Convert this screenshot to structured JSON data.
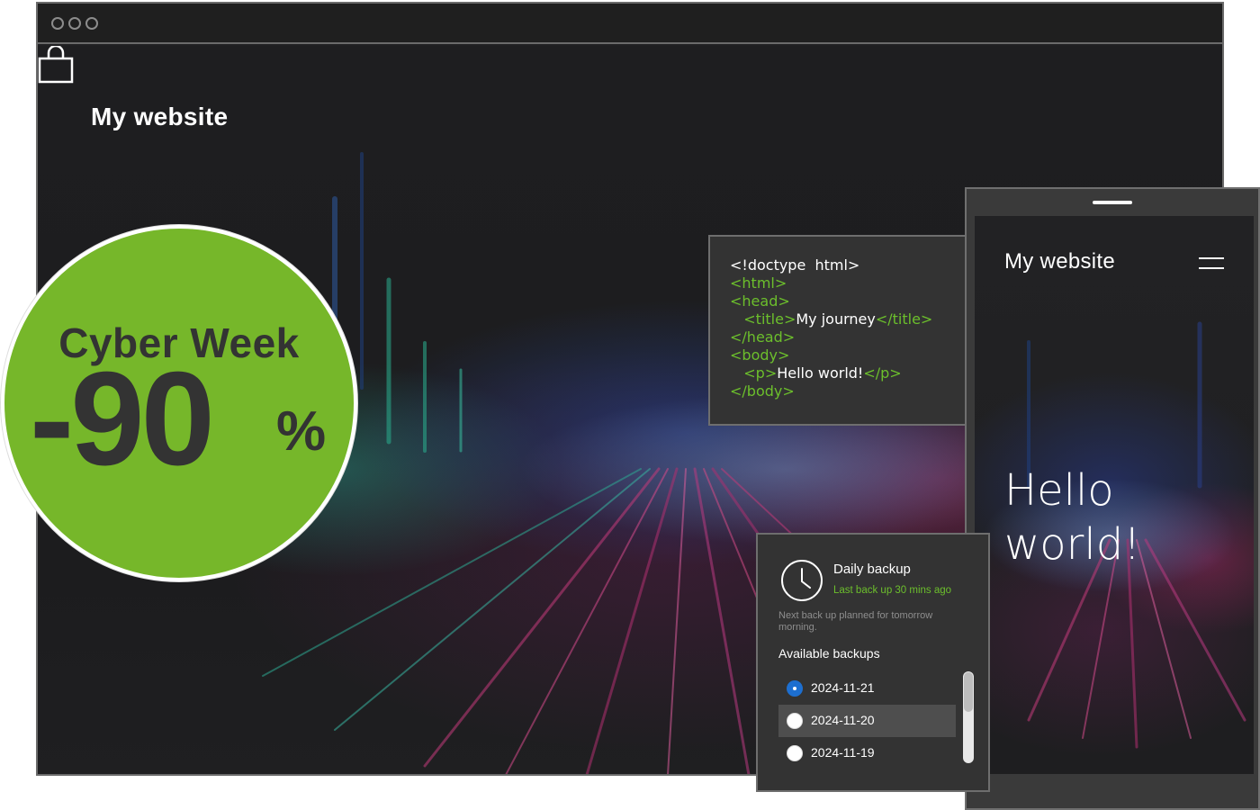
{
  "desktop": {
    "site_title": "My website",
    "cart_icon": "shopping-bag-icon",
    "window_controls": [
      "circle",
      "circle",
      "circle"
    ]
  },
  "promo": {
    "title": "Cyber Week",
    "value": "-90",
    "unit": "%",
    "background": "#76b72a",
    "text_color": "#333333"
  },
  "code_panel": {
    "lines": [
      {
        "pre": "",
        "text": "<!doctype  html>",
        "color": "white"
      },
      {
        "pre": "",
        "text": "<html>",
        "color": "green"
      },
      {
        "pre": "",
        "text": "<head>",
        "color": "green"
      },
      {
        "pre": "   ",
        "open": "<title>",
        "content": "My journey",
        "close": "</title>"
      },
      {
        "pre": "",
        "text": "</head>",
        "color": "green"
      },
      {
        "pre": "",
        "text": "<body>",
        "color": "green"
      },
      {
        "pre": "   ",
        "open": "<p>",
        "content": "Hello world!",
        "close": "</p>"
      },
      {
        "pre": "",
        "text": "</body>",
        "color": "green"
      }
    ],
    "tag_color": "#6cbf2c"
  },
  "mobile": {
    "site_title": "My website",
    "menu_icon": "hamburger-menu-icon",
    "hero_line1": "Hello",
    "hero_line2": "world!"
  },
  "backup": {
    "icon": "clock-icon",
    "title": "Daily backup",
    "last_backup": "Last back up 30 mins ago",
    "next_backup": "Next back up planned for tomorrow morning.",
    "available_label": "Available backups",
    "items": [
      {
        "date": "2024-11-21",
        "selected": true
      },
      {
        "date": "2024-11-20",
        "selected": false,
        "highlighted": true
      },
      {
        "date": "2024-11-19",
        "selected": false
      }
    ],
    "accent": "#1d6fd0",
    "status_color": "#6cbf2c"
  }
}
